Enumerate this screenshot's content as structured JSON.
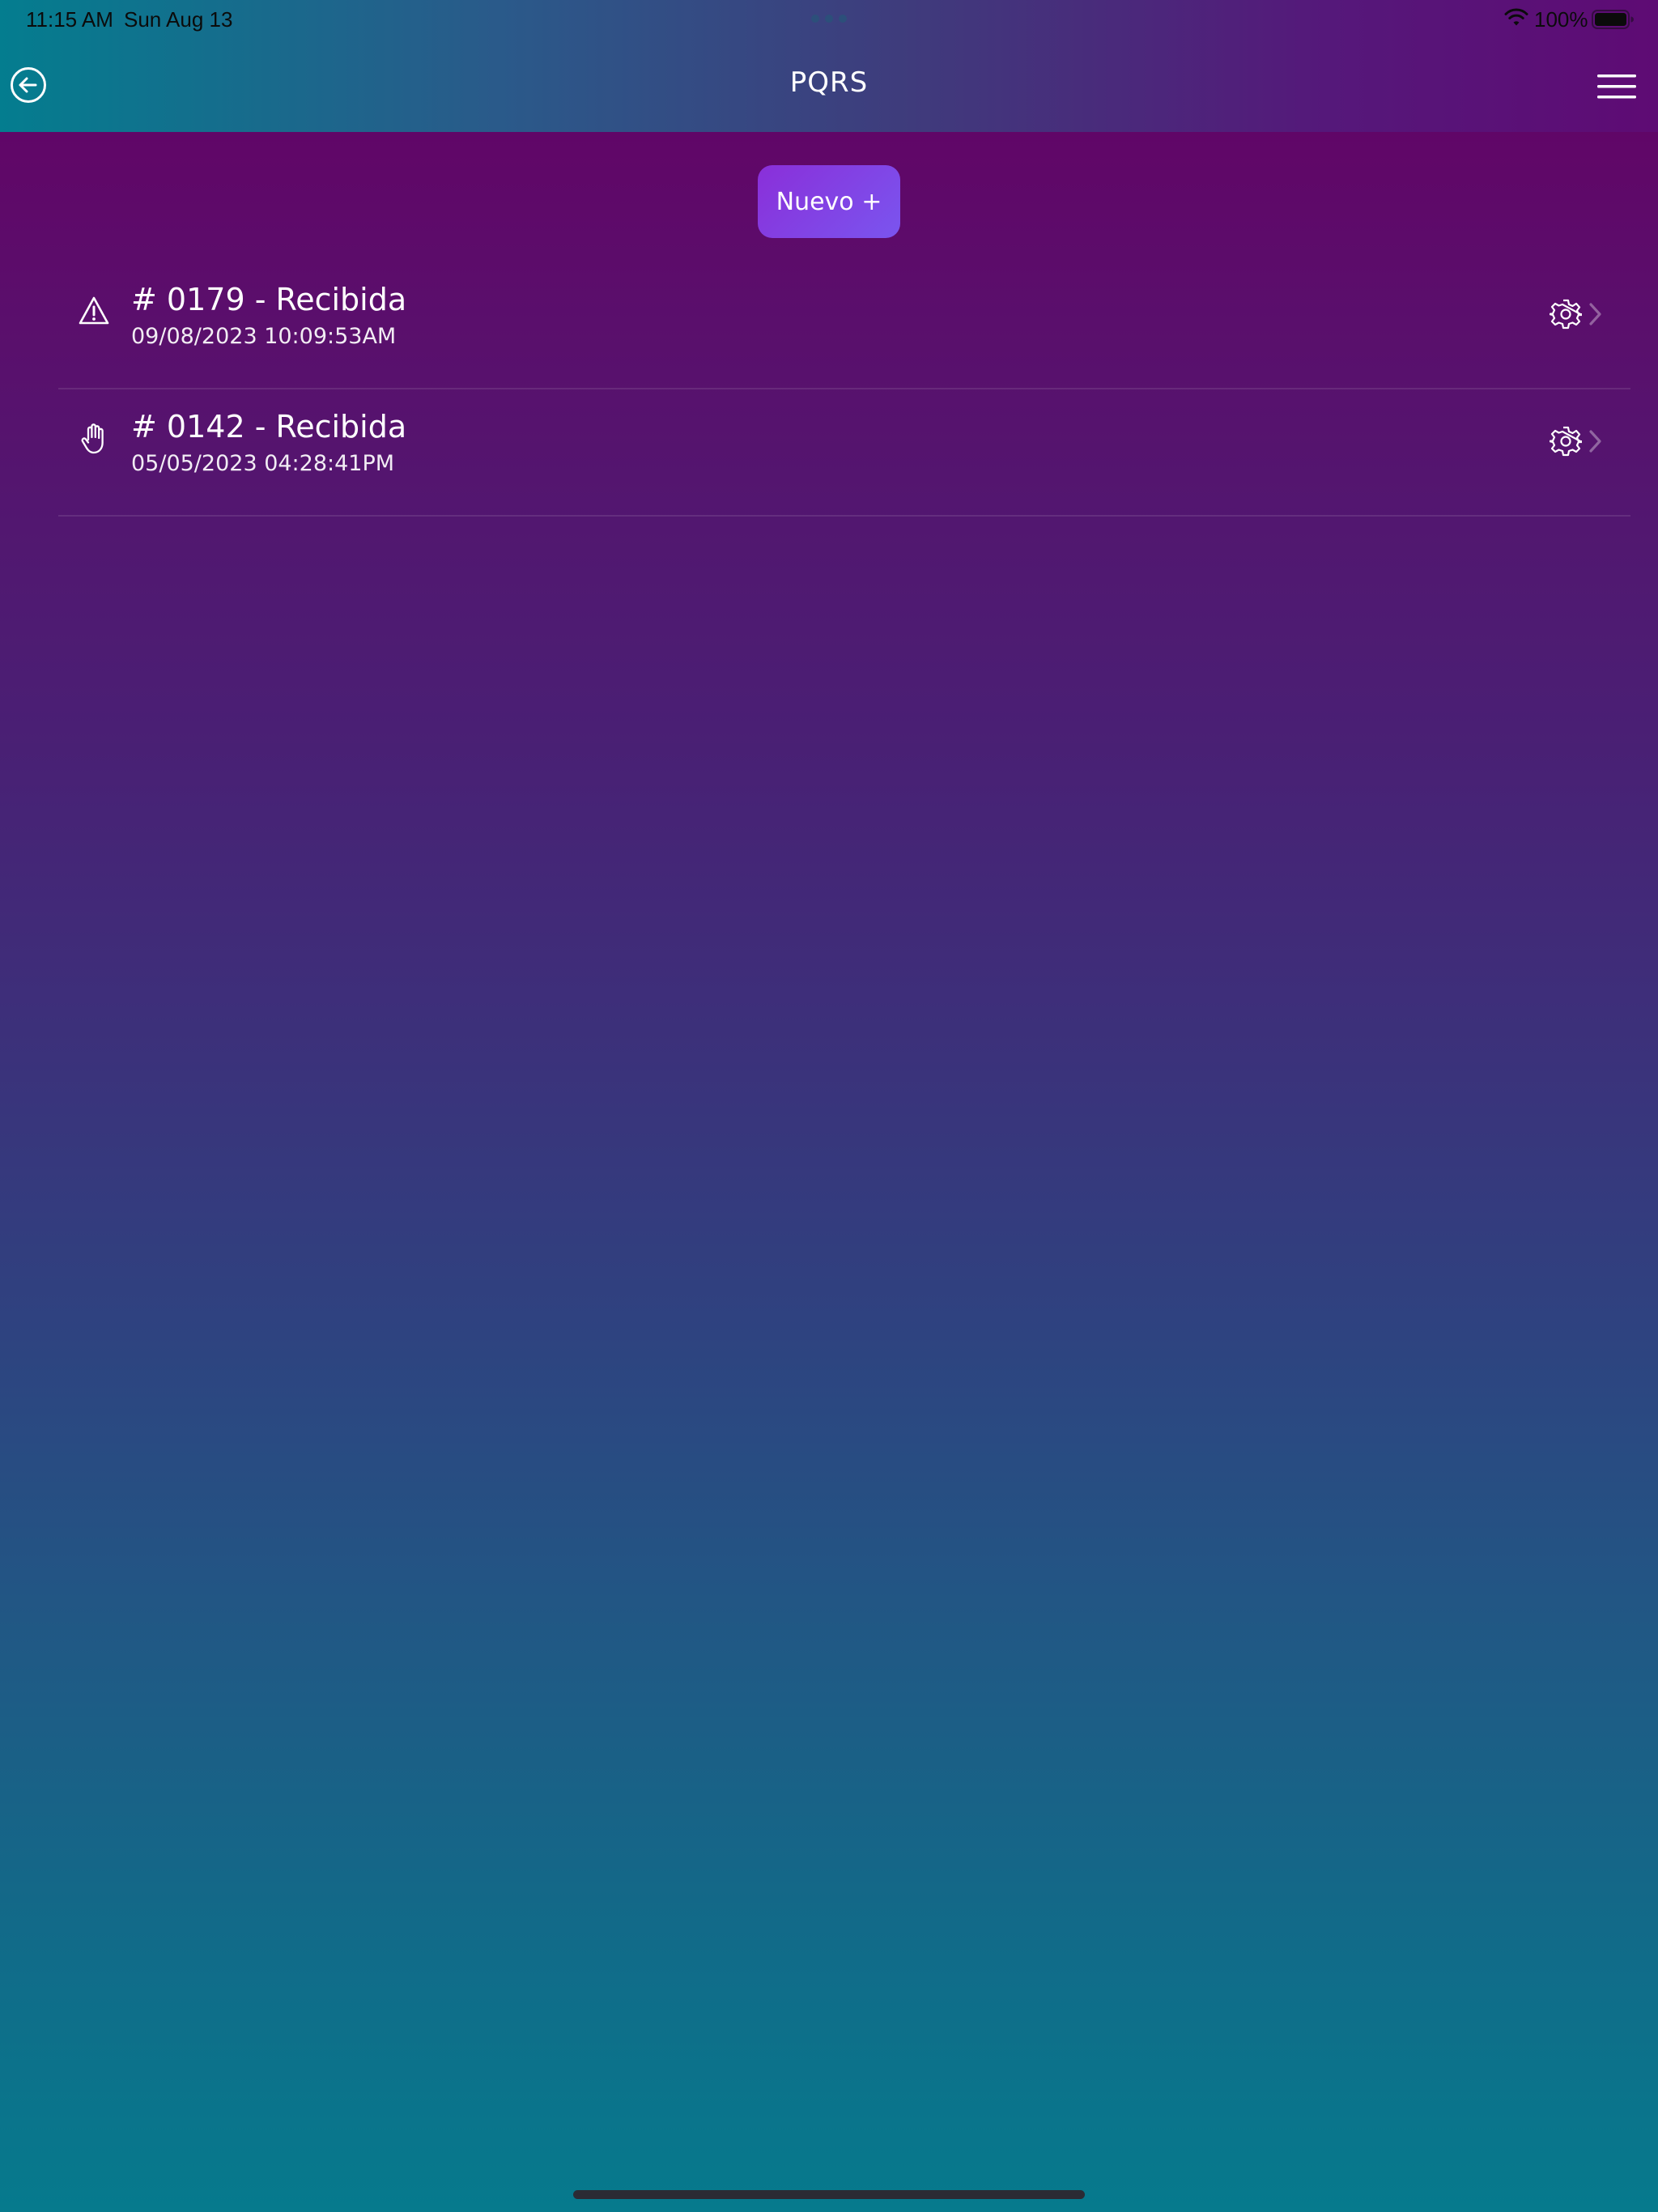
{
  "status_bar": {
    "time": "11:15 AM",
    "date": "Sun Aug 13",
    "battery": "100%",
    "icons": [
      "wifi-icon",
      "battery-icon"
    ]
  },
  "header": {
    "title": "PQRS",
    "back_icon": "arrow-left-circle-icon",
    "menu_icon": "hamburger-menu-icon"
  },
  "actions": {
    "new_label": "Nuevo +"
  },
  "items": [
    {
      "title": "# 0179 - Recibida",
      "date": "09/08/2023 10:09:53AM",
      "icon": "warning-triangle-icon",
      "action_icon": "gear-icon"
    },
    {
      "title": "# 0142 - Recibida",
      "date": "05/05/2023 04:28:41PM",
      "icon": "hand-stop-icon",
      "action_icon": "gear-icon"
    }
  ],
  "colors": {
    "header_start": "#047d8f",
    "header_end": "#5e0b74",
    "background_top": "#650064",
    "background_bottom": "#067a8d",
    "button_start": "#8a2fd9",
    "button_end": "#7a55ef"
  }
}
